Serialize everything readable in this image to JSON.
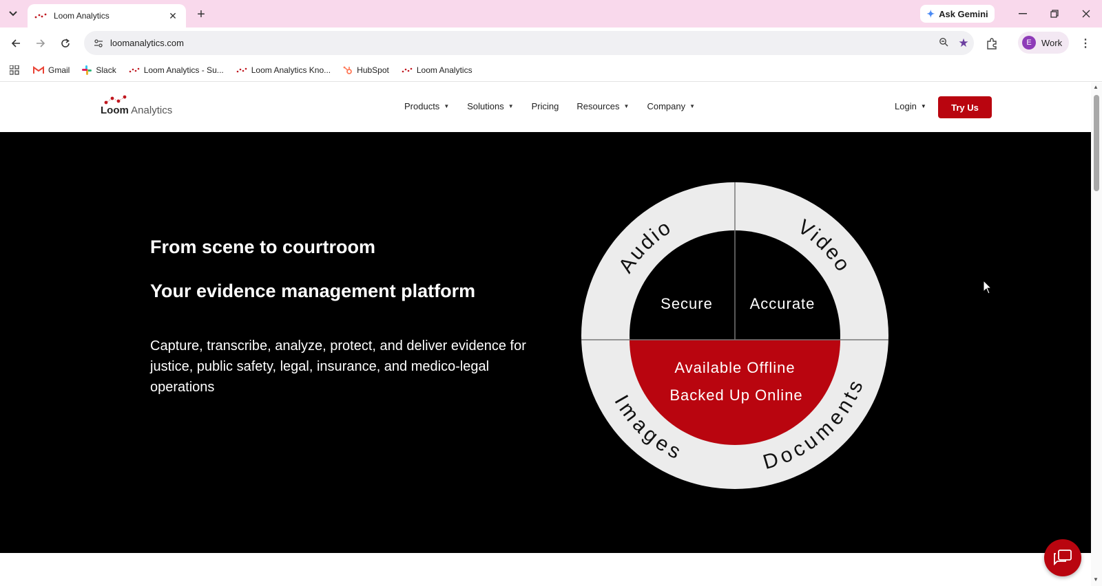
{
  "browser": {
    "tab_title": "Loom Analytics",
    "new_tab_symbol": "+",
    "tab_close_symbol": "✕",
    "ask_gemini_label": "Ask Gemini",
    "url": "loomanalytics.com",
    "profile_initial": "E",
    "profile_label": "Work",
    "bookmarks": [
      {
        "label": "Gmail",
        "icon": "gmail-icon"
      },
      {
        "label": "Slack",
        "icon": "slack-icon"
      },
      {
        "label": "Loom Analytics - Su...",
        "icon": "loom-icon"
      },
      {
        "label": "Loom Analytics Kno...",
        "icon": "loom-icon"
      },
      {
        "label": "HubSpot",
        "icon": "hubspot-icon"
      },
      {
        "label": "Loom Analytics",
        "icon": "loom-icon"
      }
    ]
  },
  "site": {
    "logo_bold": "Loom",
    "logo_light": " Analytics",
    "nav": {
      "products": "Products",
      "solutions": "Solutions",
      "pricing": "Pricing",
      "resources": "Resources",
      "company": "Company",
      "login": "Login",
      "cta": "Try Us"
    },
    "hero": {
      "heading_1": "From scene to courtroom",
      "heading_2": "Your evidence management platform",
      "body": "Capture, transcribe, analyze, protect, and deliver evidence for justice, public safety, legal, insurance, and medico-legal operations",
      "wheel": {
        "outer_audio": "Audio",
        "outer_video": "Video",
        "outer_images": "Images",
        "outer_documents": "Documents",
        "inner_left": "Secure",
        "inner_right": "Accurate",
        "bottom_line_1": "Available Offline",
        "bottom_line_2": "Backed Up Online"
      }
    }
  },
  "colors": {
    "brand_red": "#b9050f",
    "tab_strip": "#f9d9ec",
    "hero_bg": "#000000",
    "ring_gray": "#ececec"
  }
}
